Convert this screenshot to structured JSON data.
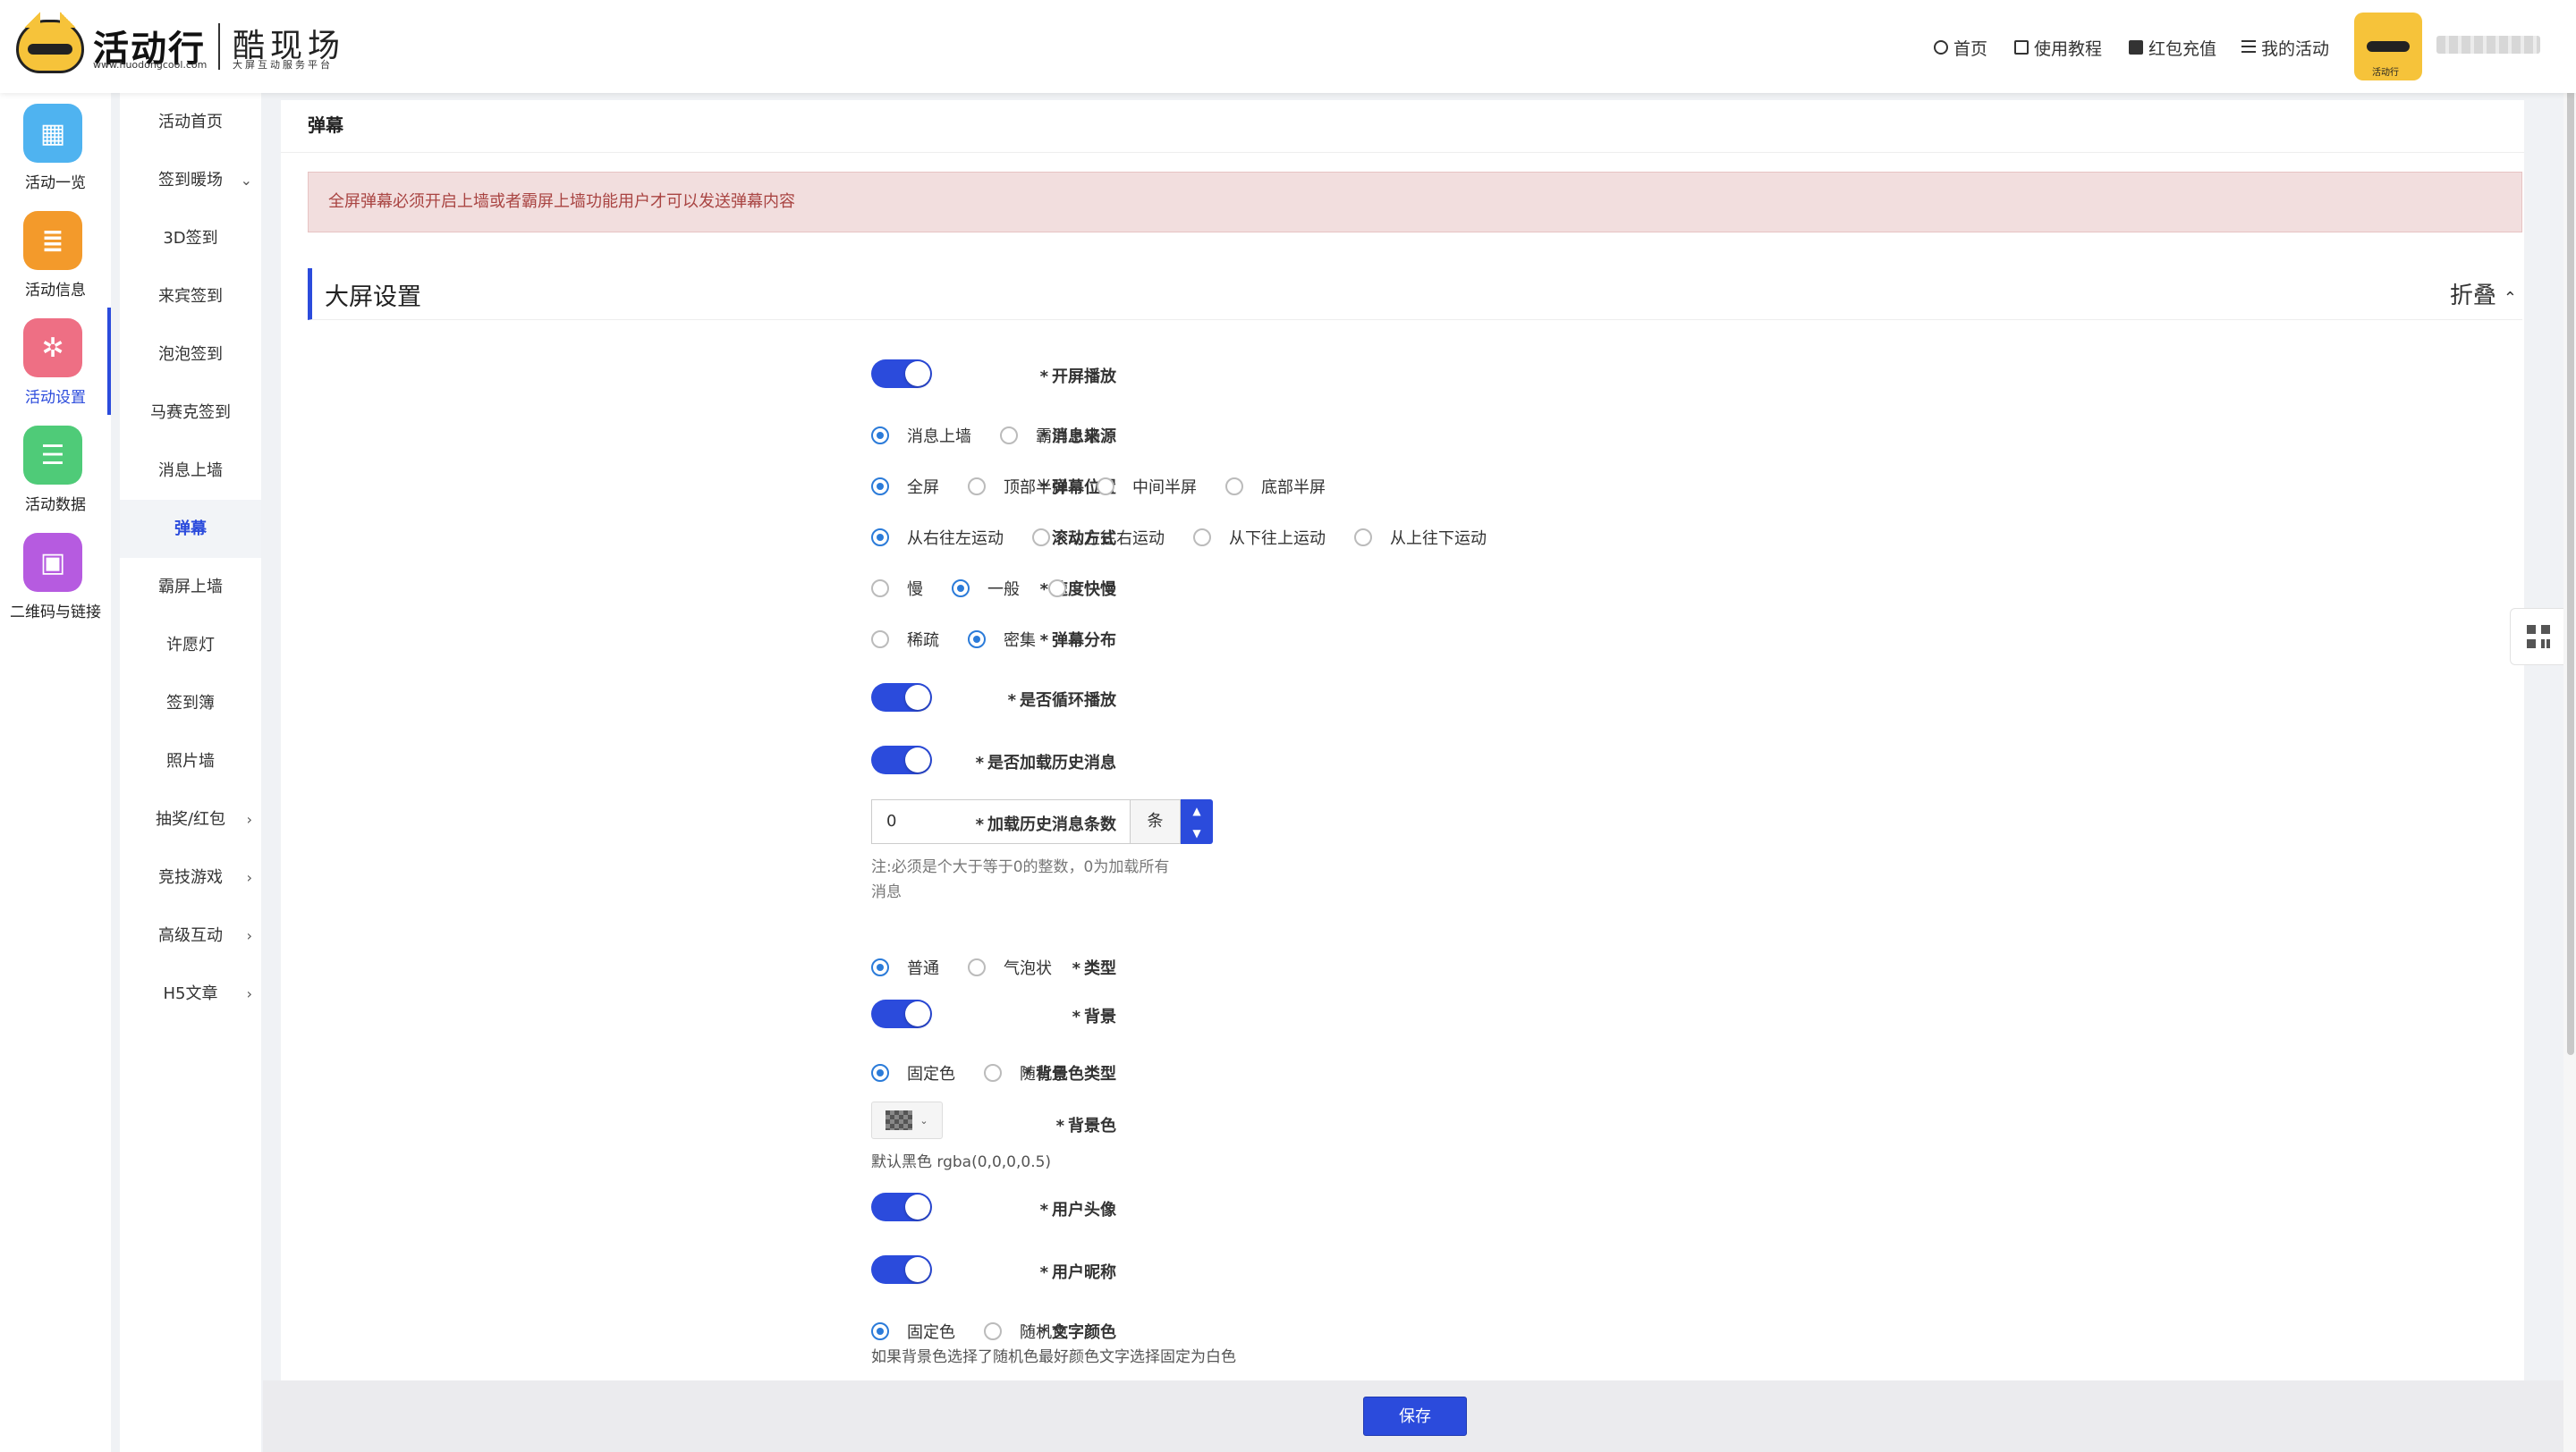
{
  "header": {
    "brand": "活动行",
    "url": "www.huodongcool.com",
    "subbrand": "酷现场",
    "subbrand_tagline": "大屏互动服务平台",
    "nav": [
      {
        "label": "首页",
        "icon": "home-icon"
      },
      {
        "label": "使用教程",
        "icon": "book-icon"
      },
      {
        "label": "红包充值",
        "icon": "redpacket-icon"
      },
      {
        "label": "我的活动",
        "icon": "list-icon"
      }
    ],
    "avatar_caption": "活动行",
    "username": "blurred"
  },
  "rail": [
    {
      "label": "活动一览",
      "icon": "grid-icon",
      "color": "#4fb3f0"
    },
    {
      "label": "活动信息",
      "icon": "document-icon",
      "color": "#f39a2b"
    },
    {
      "label": "活动设置",
      "icon": "gear-icon",
      "color": "#ee6f84",
      "active": true
    },
    {
      "label": "活动数据",
      "icon": "database-icon",
      "color": "#4fcb78"
    },
    {
      "label": "二维码与链接",
      "icon": "qrcode-icon",
      "color": "#b65be0"
    }
  ],
  "subnav": [
    {
      "label": "活动首页"
    },
    {
      "label": "签到暖场",
      "chevron": "⌄"
    },
    {
      "label": "3D签到"
    },
    {
      "label": "来宾签到"
    },
    {
      "label": "泡泡签到"
    },
    {
      "label": "马赛克签到"
    },
    {
      "label": "消息上墙"
    },
    {
      "label": "弹幕",
      "active": true
    },
    {
      "label": "霸屏上墙"
    },
    {
      "label": "许愿灯"
    },
    {
      "label": "签到簿"
    },
    {
      "label": "照片墙"
    },
    {
      "label": "抽奖/红包",
      "chevron": "›"
    },
    {
      "label": "竞技游戏",
      "chevron": "›"
    },
    {
      "label": "高级互动",
      "chevron": "›"
    },
    {
      "label": "H5文章",
      "chevron": "›"
    }
  ],
  "main": {
    "page_title": "弹幕",
    "alert": "全屏弹幕必须开启上墙或者霸屏上墙功能用户才可以发送弹幕内容",
    "section_title": "大屏设置",
    "collapse_label": "折叠",
    "collapse_caret": "⌃",
    "fields": {
      "open_screen": {
        "label": "开屏播放",
        "on": true
      },
      "source": {
        "label": "消息来源",
        "options": [
          "消息上墙",
          "霸屏上墙"
        ],
        "selected": 0
      },
      "position": {
        "label": "弹幕位置",
        "options": [
          "全屏",
          "顶部半屏",
          "中间半屏",
          "底部半屏"
        ],
        "selected": 0
      },
      "scroll": {
        "label": "滚动方式",
        "options": [
          "从右往左运动",
          "从左往右运动",
          "从下往上运动",
          "从上往下运动"
        ],
        "selected": 0
      },
      "speed": {
        "label": "速度快慢",
        "options": [
          "慢",
          "一般",
          "快"
        ],
        "selected": 1
      },
      "density": {
        "label": "弹幕分布",
        "options": [
          "稀疏",
          "密集"
        ],
        "selected": 1
      },
      "loop": {
        "label": "是否循环播放",
        "on": true
      },
      "history": {
        "label": "是否加载历史消息",
        "on": true
      },
      "history_count": {
        "label": "加载历史消息条数",
        "value": "0",
        "unit": "条",
        "hint_line1": "注:必须是个大于等于0的整数，0为加载所有",
        "hint_line2": "消息"
      },
      "type": {
        "label": "类型",
        "options": [
          "普通",
          "气泡状"
        ],
        "selected": 0
      },
      "background": {
        "label": "背景",
        "on": true
      },
      "bg_color_type": {
        "label": "背景色类型",
        "options": [
          "固定色",
          "随机色"
        ],
        "selected": 0
      },
      "bg_color": {
        "label": "背景色",
        "hint": "默认黑色 rgba(0,0,0,0.5)",
        "value": "rgba(0,0,0,0.5)"
      },
      "avatar": {
        "label": "用户头像",
        "on": true
      },
      "nickname": {
        "label": "用户昵称",
        "on": true
      },
      "text_color": {
        "label": "文字颜色",
        "options": [
          "固定色",
          "随机色"
        ],
        "selected": 0,
        "hint": "如果背景色选择了随机色最好颜色文字选择固定为白色"
      }
    }
  },
  "footer": {
    "save_label": "保存"
  },
  "colors": {
    "primary": "#2b4bdc",
    "radio_on": "#2b7bd9",
    "alert_bg": "#f2dede",
    "alert_text": "#a94442"
  }
}
